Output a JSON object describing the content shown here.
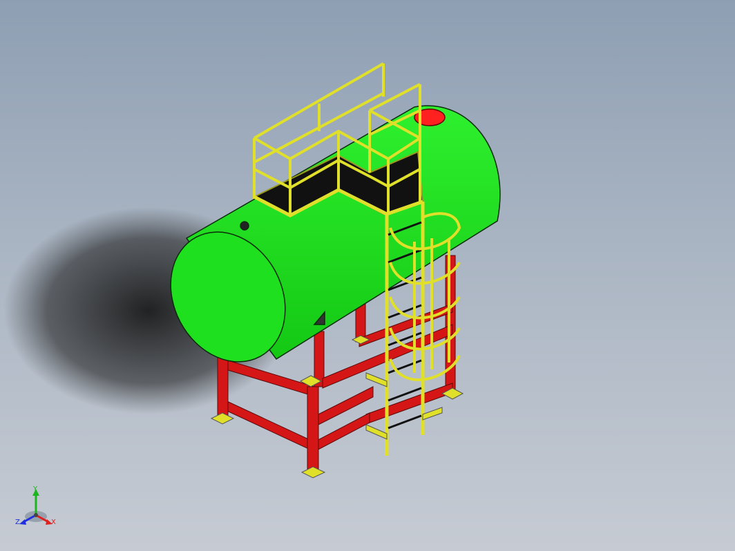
{
  "viewport": {
    "background_top": "#8e9fb3",
    "background_bottom": "#c6cbd3"
  },
  "model": {
    "tank_color": "#1fe01f",
    "frame_color": "#d51616",
    "platform_color": "#e0e02a",
    "hatch_color": "#ff2020"
  },
  "triad": {
    "y_label": "Y",
    "z_label": "Z",
    "x_label": "X",
    "y_color": "#1db51d",
    "z_color": "#1f2fe0",
    "x_color": "#e01f1f"
  }
}
